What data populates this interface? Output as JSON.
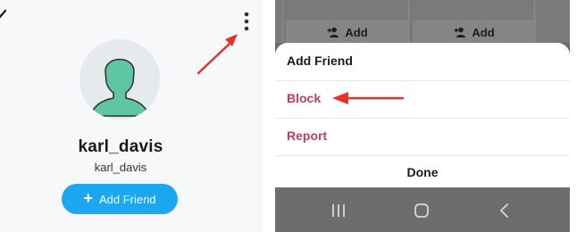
{
  "profile": {
    "display_name": "karl_davis",
    "username": "karl_davis",
    "add_friend_label": "Add Friend",
    "back_icon": "chevron-left-icon",
    "more_icon": "more-vertical-icon",
    "avatar_color": "#5fc6a4"
  },
  "background_buttons": [
    {
      "label": "Add",
      "icon": "add-person-icon"
    },
    {
      "label": "Add",
      "icon": "add-person-icon"
    }
  ],
  "menu": {
    "items": [
      {
        "label": "Add Friend",
        "color": "#1a1a1a"
      },
      {
        "label": "Block",
        "color": "#b3415e"
      },
      {
        "label": "Report",
        "color": "#b3415e"
      }
    ],
    "done_label": "Done"
  },
  "navbar": {
    "icons": [
      "recent-apps-icon",
      "home-icon",
      "back-icon"
    ]
  },
  "annotations": {
    "arrow_color": "#e8302a"
  }
}
